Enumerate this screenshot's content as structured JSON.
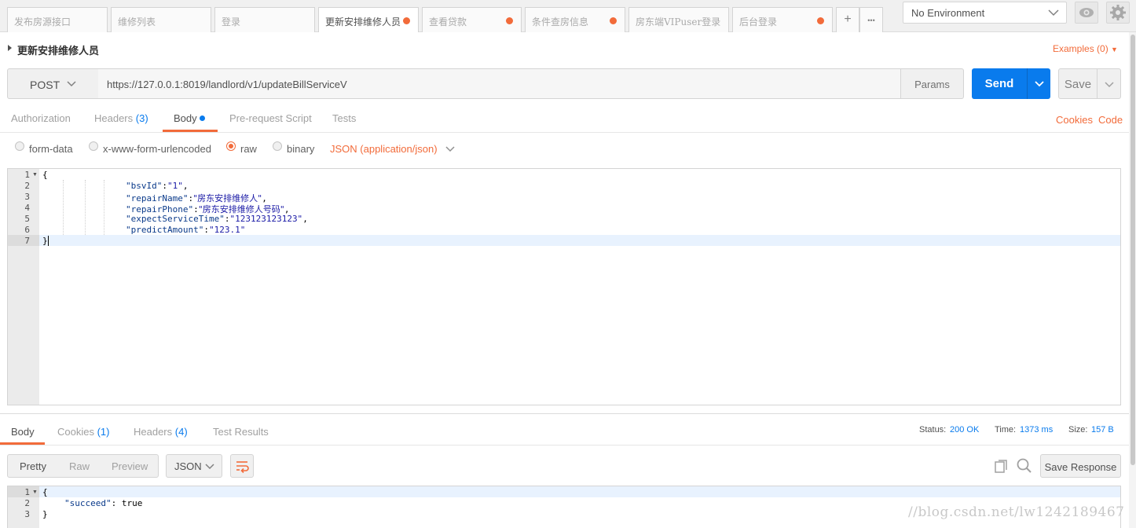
{
  "tabs": [
    {
      "label": "发布房源接口",
      "dot": false
    },
    {
      "label": "维修列表",
      "dot": false
    },
    {
      "label": "登录",
      "dot": false
    },
    {
      "label": "更新安排维修人员",
      "dot": true,
      "active": true
    },
    {
      "label": "查看贷款",
      "dot": true
    },
    {
      "label": "条件查房信息",
      "dot": true
    },
    {
      "label": "房东端VIPuser登录",
      "dot": false
    },
    {
      "label": "后台登录",
      "dot": true
    }
  ],
  "toolbar": {
    "new_tab": "+",
    "more": "•••"
  },
  "environment": {
    "selected": "No Environment"
  },
  "request": {
    "title": "更新安排维修人员",
    "examples": "Examples (0)",
    "method": "POST",
    "url": "https://127.0.0.1:8019/landlord/v1/updateBillServiceV",
    "params_label": "Params",
    "send_label": "Send",
    "save_label": "Save"
  },
  "request_tabs": {
    "authorization": "Authorization",
    "headers": "Headers",
    "headers_count": "(3)",
    "body": "Body",
    "prerequest": "Pre-request Script",
    "tests": "Tests",
    "cookies": "Cookies",
    "code": "Code"
  },
  "body_options": {
    "form_data": "form-data",
    "urlencoded": "x-www-form-urlencoded",
    "raw": "raw",
    "binary": "binary",
    "selected": "raw",
    "content_type": "JSON (application/json)"
  },
  "request_body": {
    "line_numbers": [
      "1",
      "2",
      "3",
      "4",
      "5",
      "6",
      "7"
    ],
    "open": "{",
    "close": "}",
    "fields": [
      {
        "key": "\"bsvId\"",
        "value": "\"1\"",
        "trail": ","
      },
      {
        "key": "\"repairName\"",
        "value": "\"房东安排维修人\"",
        "trail": ","
      },
      {
        "key": "\"repairPhone\"",
        "value": "\"房东安排维修人号码\"",
        "trail": ","
      },
      {
        "key": "\"expectServiceTime\"",
        "value": "\"123123123123\"",
        "trail": ","
      },
      {
        "key": "\"predictAmount\"",
        "value": "\"123.1\"",
        "trail": ""
      }
    ]
  },
  "response_tabs": {
    "body": "Body",
    "cookies": "Cookies",
    "cookies_count": "(1)",
    "headers": "Headers",
    "headers_count": "(4)",
    "test_results": "Test Results"
  },
  "response_meta": {
    "status_label": "Status:",
    "status_value": "200 OK",
    "time_label": "Time:",
    "time_value": "1373 ms",
    "size_label": "Size:",
    "size_value": "157 B"
  },
  "response_view": {
    "pretty": "Pretty",
    "raw": "Raw",
    "preview": "Preview",
    "format": "JSON",
    "save_response": "Save Response"
  },
  "response_body": {
    "line_numbers": [
      "1",
      "2",
      "3"
    ],
    "open": "{",
    "key": "\"succeed\"",
    "value": "true",
    "close": "}"
  },
  "watermark": "//blog.csdn.net/lw1242189467",
  "colors": {
    "accent": "#f26b3a",
    "primary": "#097bed"
  }
}
